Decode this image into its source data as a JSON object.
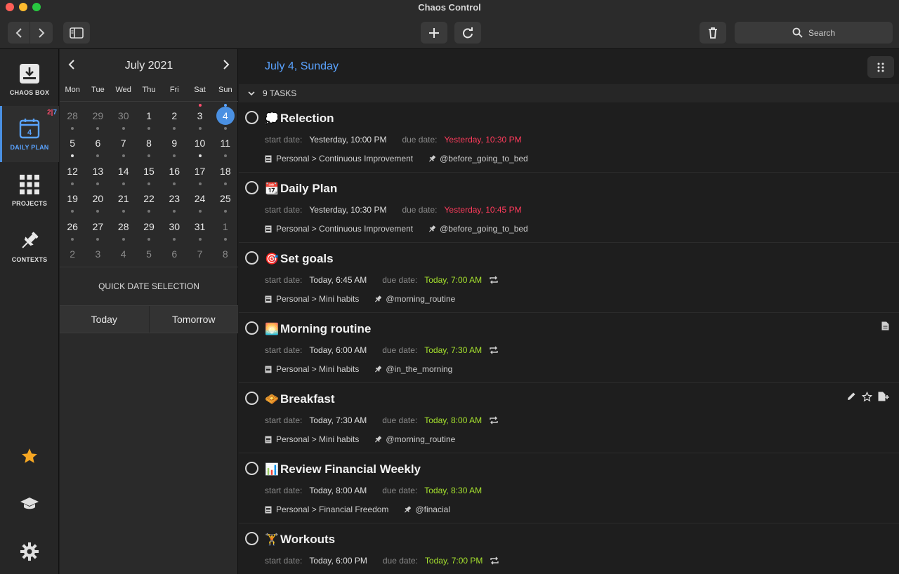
{
  "window": {
    "title": "Chaos Control"
  },
  "toolbar": {
    "search_label": "Search"
  },
  "sidebar": {
    "items": [
      {
        "label": "CHAOS BOX",
        "icon": "inbox-download-icon"
      },
      {
        "label": "DAILY PLAN",
        "icon": "calendar-icon",
        "badge_a": "2",
        "badge_sep": "|",
        "badge_b": "7",
        "day": "4"
      },
      {
        "label": "PROJECTS",
        "icon": "grid-icon"
      },
      {
        "label": "CONTEXTS",
        "icon": "pin-icon"
      }
    ],
    "accent_color": "#4a90e2",
    "star_color": "#f5a623"
  },
  "calendar": {
    "month_label": "July 2021",
    "weekdays": [
      "Mon",
      "Tue",
      "Wed",
      "Thu",
      "Fri",
      "Sat",
      "Sun"
    ],
    "weeks": [
      [
        "28",
        "29",
        "30",
        "1",
        "2",
        "3",
        "4"
      ],
      [
        "5",
        "6",
        "7",
        "8",
        "9",
        "10",
        "11"
      ],
      [
        "12",
        "13",
        "14",
        "15",
        "16",
        "17",
        "18"
      ],
      [
        "19",
        "20",
        "21",
        "22",
        "23",
        "24",
        "25"
      ],
      [
        "26",
        "27",
        "28",
        "29",
        "30",
        "31",
        "1"
      ],
      [
        "2",
        "3",
        "4",
        "5",
        "6",
        "7",
        "8"
      ]
    ],
    "selected_day": "4",
    "quick_label": "QUICK DATE SELECTION",
    "today_label": "Today",
    "tomorrow_label": "Tomorrow"
  },
  "main": {
    "day_title": "July 4, Sunday",
    "task_count_label": "9 TASKS",
    "start_key": "start date:",
    "due_key": "due date:",
    "tasks": [
      {
        "emoji": "💭",
        "title": "Relection",
        "start": "Yesterday, 10:00 PM",
        "due": "Yesterday, 10:30 PM",
        "due_status": "overdue",
        "project": "Personal > Continuous Improvement",
        "context": "@before_going_to_bed",
        "repeat": false
      },
      {
        "emoji": "📆",
        "title": "Daily Plan",
        "start": "Yesterday, 10:30 PM",
        "due": "Yesterday, 10:45 PM",
        "due_status": "overdue",
        "project": "Personal > Continuous Improvement",
        "context": "@before_going_to_bed",
        "repeat": false
      },
      {
        "emoji": "🎯",
        "title": "Set goals",
        "start": "Today, 6:45 AM",
        "due": "Today, 7:00 AM",
        "due_status": "upcoming",
        "project": "Personal > Mini habits",
        "context": "@morning_routine",
        "repeat": true
      },
      {
        "emoji": "🌅",
        "title": "Morning routine",
        "start": "Today, 6:00 AM",
        "due": "Today, 7:30 AM",
        "due_status": "upcoming",
        "project": "Personal > Mini habits",
        "context": "@in_the_morning",
        "repeat": true
      },
      {
        "emoji": "🧇",
        "title": " Breakfast",
        "start": "Today, 7:30 AM",
        "due": "Today, 8:00 AM",
        "due_status": "upcoming",
        "project": "Personal > Mini habits",
        "context": "@morning_routine",
        "repeat": true
      },
      {
        "emoji": "📊",
        "title": "Review Financial Weekly",
        "start": "Today, 8:00 AM",
        "due": "Today, 8:30 AM",
        "due_status": "upcoming",
        "project": "Personal > Financial Freedom",
        "context": "@finacial",
        "repeat": false
      },
      {
        "emoji": "🏋",
        "title": "Workouts",
        "start": "Today, 6:00 PM",
        "due": "Today, 7:00 PM",
        "due_status": "upcoming",
        "project": "",
        "context": "",
        "repeat": true
      }
    ],
    "colors": {
      "overdue": "#ff3b5c",
      "upcoming": "#a6e22e",
      "title_accent": "#5aa3ff"
    }
  }
}
